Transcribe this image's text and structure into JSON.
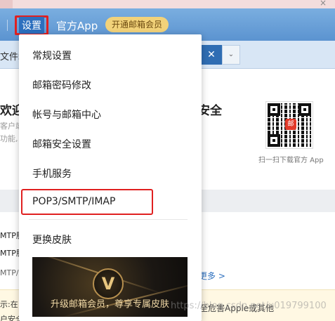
{
  "header": {
    "settings_label": "设置",
    "app_label": "官方App",
    "vip_label": "开通邮箱会员"
  },
  "toolbar": {
    "file_label": "文件箱",
    "close_label": "✕",
    "down_label": "⌄"
  },
  "content": {
    "welcome_text": "欢迎您使",
    "sec_word": "安全",
    "sub1": "客户端",
    "sub2": "功能,",
    "rows": [
      "MTP服",
      "MTP服",
      "MTP/I"
    ],
    "more_link": "更多 >",
    "qr_caption": "扫一扫下载官方 App",
    "qr_badge": "邮",
    "notice_1": "示:在",
    "notice_2": "甚至危害Apple或其他",
    "notice_3": "户安全"
  },
  "dropdown": {
    "items": [
      {
        "label": "常规设置"
      },
      {
        "label": "邮箱密码修改"
      },
      {
        "label": "帐号与邮箱中心"
      },
      {
        "label": "邮箱安全设置"
      },
      {
        "label": "手机服务"
      },
      {
        "label": "POP3/SMTP/IMAP"
      },
      {
        "label": "更换皮肤"
      }
    ],
    "promo_badge": "V",
    "promo_text": "升级邮箱会员，尊享专属皮肤"
  },
  "watermark": "https://blog.csdn.net/u019799100"
}
